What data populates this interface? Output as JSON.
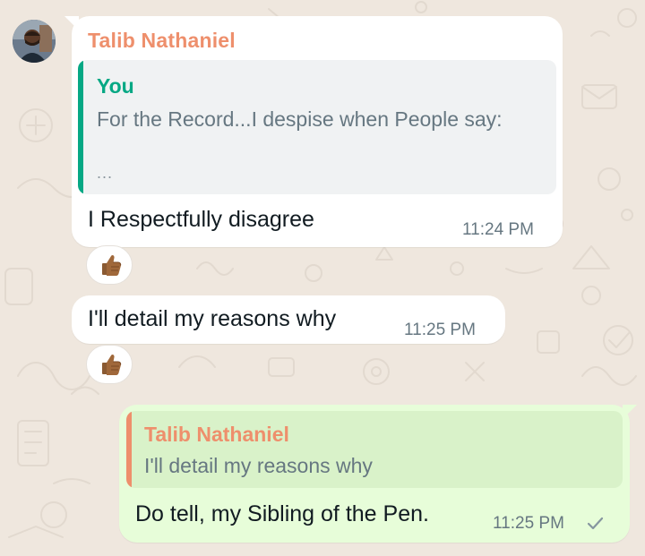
{
  "chat": {
    "contact_name": "Talib Nathaniel",
    "avatar_icon": "contact-avatar-photo"
  },
  "messages": [
    {
      "direction": "incoming",
      "sender": "Talib Nathaniel",
      "quoted": {
        "author": "You",
        "text": "For the Record...I despise when People say:",
        "ellipsis": "..."
      },
      "text": "I Respectfully disagree",
      "time": "11:24 PM",
      "reaction": "thumbs-up-medium-dark-skin-emoji"
    },
    {
      "direction": "incoming",
      "text": "I'll detail my reasons why",
      "time": "11:25 PM",
      "reaction": "thumbs-up-medium-dark-skin-emoji"
    },
    {
      "direction": "outgoing",
      "quoted": {
        "author": "Talib Nathaniel",
        "text": "I'll detail my reasons why"
      },
      "text": "Do tell, my Sibling of the Pen.",
      "time": "11:25 PM",
      "status_icon": "single-check-icon"
    }
  ],
  "colors": {
    "wallpaper": "#efe7de",
    "incoming_bubble": "#ffffff",
    "outgoing_bubble": "#e7fdd9",
    "sender_name": "#ee8f6c",
    "you_quote_accent": "#06a884",
    "meta_text": "#667781"
  }
}
